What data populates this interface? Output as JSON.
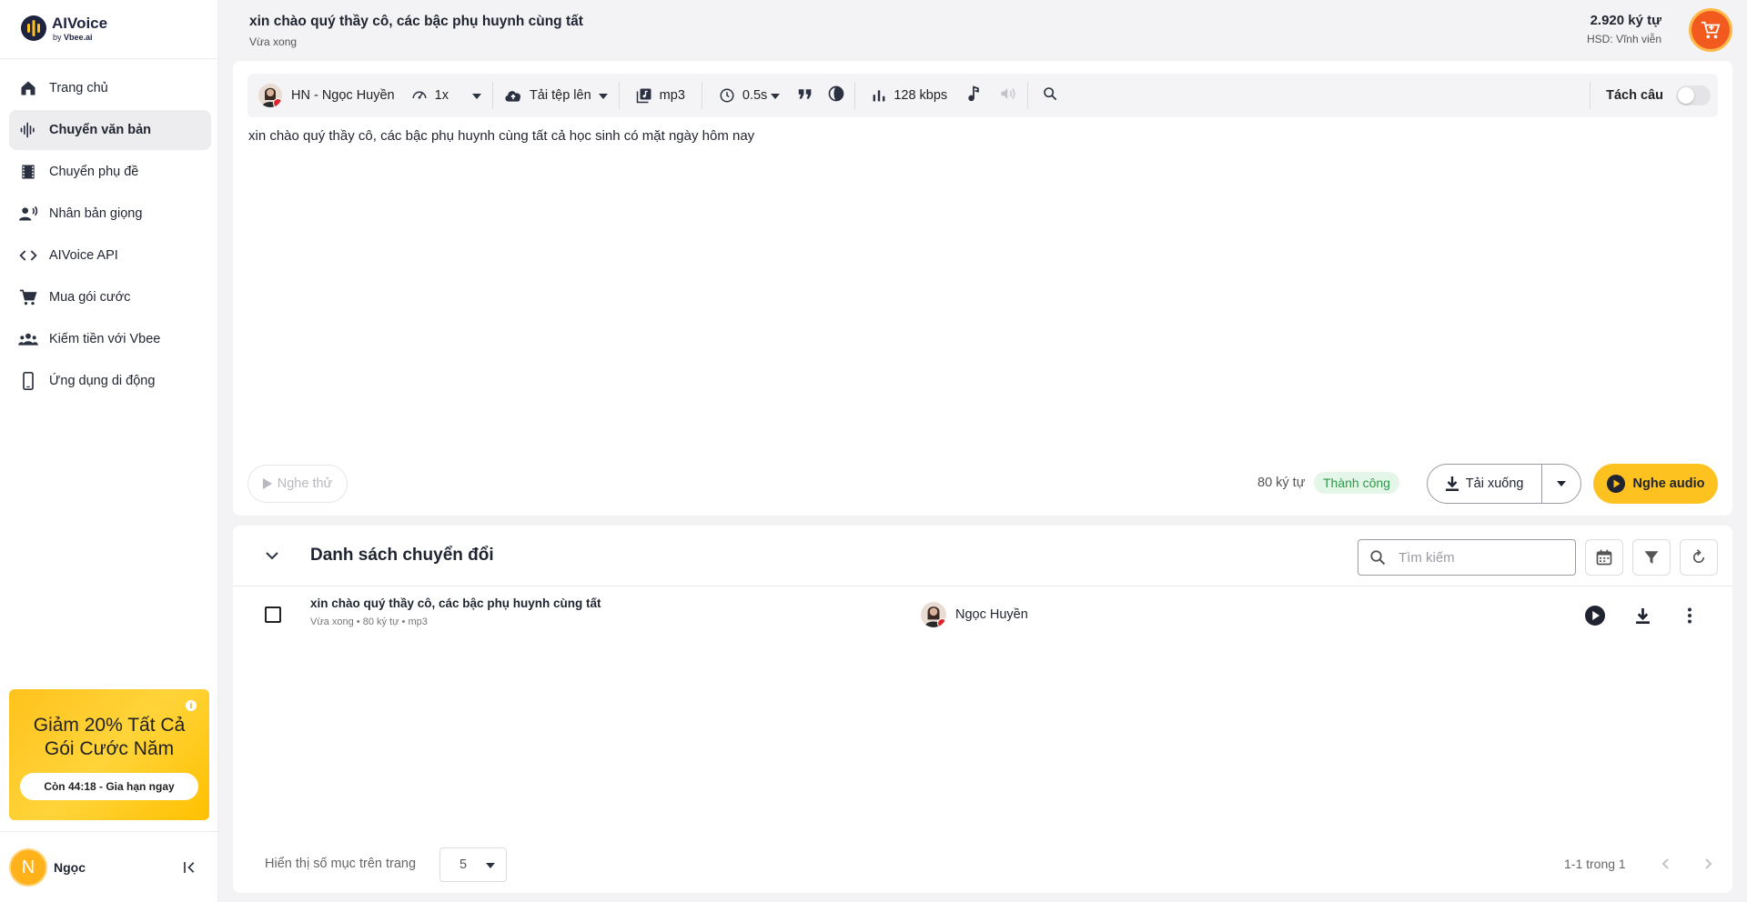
{
  "app": {
    "logo_name": "AIVoice",
    "logo_by": "by",
    "logo_brand": "Vbee.ai"
  },
  "sidebar": {
    "items": [
      {
        "label": "Trang chủ",
        "icon": "home-icon"
      },
      {
        "label": "Chuyển văn bản",
        "icon": "waveform-icon",
        "active": true
      },
      {
        "label": "Chuyển phụ đề",
        "icon": "film-icon"
      },
      {
        "label": "Nhân bản giọng",
        "icon": "voice-clone-icon"
      },
      {
        "label": "AIVoice API",
        "icon": "code-icon"
      },
      {
        "label": "Mua gói cước",
        "icon": "cart-icon"
      },
      {
        "label": "Kiếm tiền với Vbee",
        "icon": "people-icon"
      },
      {
        "label": "Ứng dụng di động",
        "icon": "phone-icon"
      }
    ],
    "promo": {
      "title_line1": "Giảm 20% Tất Cả",
      "title_line2": "Gói Cước Năm",
      "button": "Còn 44:18 - Gia hạn ngay",
      "info": "i"
    },
    "user": {
      "initial": "N",
      "name": "Ngọc"
    }
  },
  "header": {
    "title": "xin chào quý thầy cô, các bậc phụ huynh cùng tất",
    "subtitle": "Vừa xong",
    "credits": "2.920 ký tự",
    "expiry": "HSD: Vĩnh viễn"
  },
  "toolbar": {
    "voice": "HN - Ngọc Huyền",
    "speed": "1x",
    "upload": "Tải tệp lên",
    "format": "mp3",
    "pause": "0.5s",
    "bitrate": "128 kbps",
    "split_label": "Tách câu"
  },
  "editor": {
    "text": "xin chào quý thầy cô, các bậc phụ huynh cùng tất cả học sinh có mặt ngày hôm nay",
    "preview": "Nghe thử",
    "char_count": "80 ký tự",
    "status": "Thành công",
    "download": "Tải xuống",
    "listen": "Nghe audio"
  },
  "list": {
    "title": "Danh sách chuyển đổi",
    "search_placeholder": "Tìm kiếm",
    "rows": [
      {
        "title": "xin chào quý thầy cô, các bậc phụ huynh cùng tất",
        "meta_time": "Vừa xong",
        "meta_chars": "80 ký tự",
        "meta_format": "mp3",
        "voice": "Ngọc Huyền"
      }
    ],
    "footer": {
      "per_page_label": "Hiển thị số mục trên trang",
      "per_page": "5",
      "page_info": "1-1 trong 1"
    }
  },
  "colors": {
    "accent_yellow": "#fdc21f",
    "cart_orange": "#f25a1e",
    "success_green": "#2c9a4a"
  }
}
